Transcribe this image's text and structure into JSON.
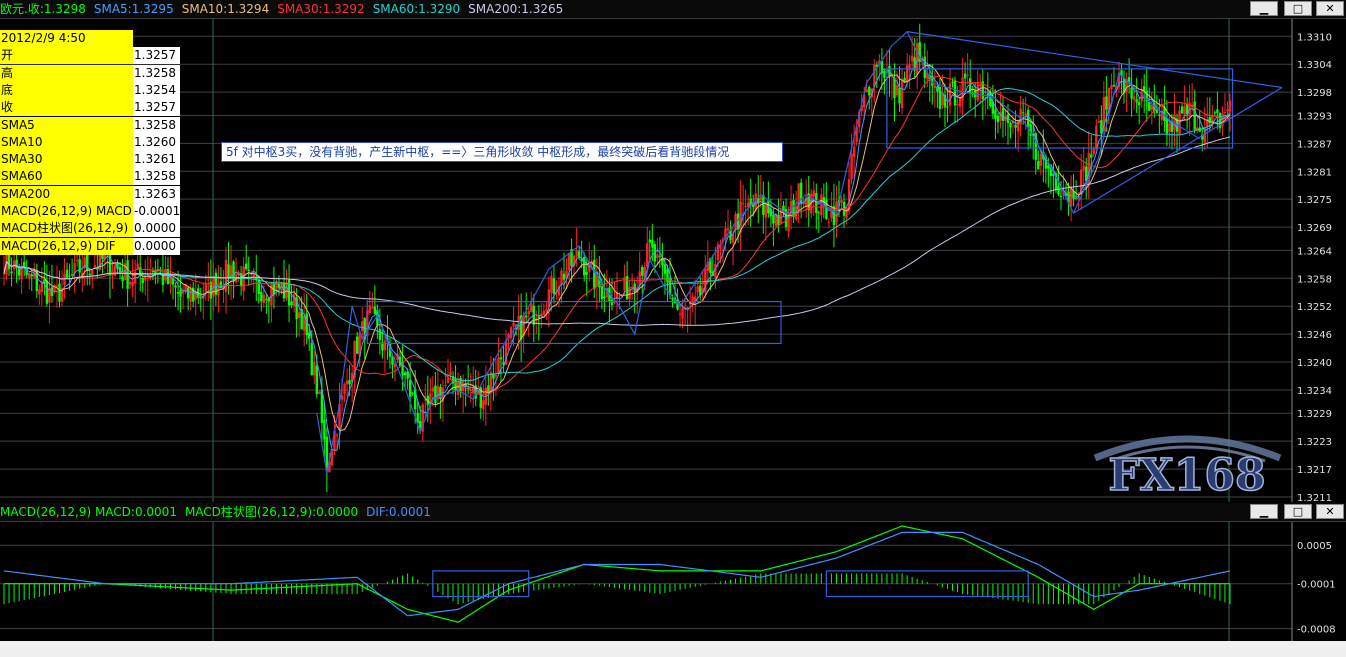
{
  "window": {
    "title_parts": [
      {
        "text": "欧元.收:1.3298",
        "color": "#00ff00"
      },
      {
        "text": "SMA5:1.3295",
        "color": "#40a0ff"
      },
      {
        "text": "SMA10:1.3294",
        "color": "#e8c070"
      },
      {
        "text": "SMA30:1.3292",
        "color": "#ff3030"
      },
      {
        "text": "SMA60:1.3290",
        "color": "#20d0d0"
      },
      {
        "text": "SMA200:1.3265",
        "color": "#c8c8e8"
      }
    ],
    "minimize": "▁",
    "maximize": "□",
    "close": "✕"
  },
  "info": {
    "rows": [
      {
        "k": "2012/2/9 4:50",
        "v": ""
      },
      {
        "k": "开",
        "v": "1.3257"
      },
      {
        "k": "高",
        "v": "1.3258"
      },
      {
        "k": "底",
        "v": "1.3254"
      },
      {
        "k": "收",
        "v": "1.3257"
      },
      {
        "k": "SMA5",
        "v": "1.3258"
      },
      {
        "k": "SMA10",
        "v": "1.3260"
      },
      {
        "k": "SMA30",
        "v": "1.3261"
      },
      {
        "k": "SMA60",
        "v": "1.3258"
      },
      {
        "k": "SMA200",
        "v": "1.3263"
      },
      {
        "k": "MACD(26,12,9) MACD",
        "v": "-0.0001"
      },
      {
        "k": "MACD柱状图(26,12,9)",
        "v": "0.0000"
      },
      {
        "k": "MACD(26,12,9) DIF",
        "v": "0.0000"
      }
    ]
  },
  "annotation": "5f 对中枢3买，没有背驰，产生新中枢，==〉三角形收敛 中枢形成，最终突破后看背驰段情况",
  "macd_title_parts": [
    {
      "text": "MACD(26,12,9) MACD:0.0001",
      "color": "#00ff00"
    },
    {
      "text": "MACD柱状图(26,12,9):0.0000",
      "color": "#00ff00"
    },
    {
      "text": "DIF:0.0001",
      "color": "#4090ff"
    }
  ],
  "watermark": "FX168",
  "colors": {
    "up": "#ff2020",
    "down": "#00ff00",
    "sma5": "#40a0ff",
    "sma10": "#e8c070",
    "sma30": "#ff3030",
    "sma60": "#20d0d0",
    "sma200": "#c8c8e8",
    "annot": "#3060e0",
    "grid": "#404040",
    "macd": "#00ff00",
    "dif": "#4090ff"
  },
  "chart_data": [
    {
      "type": "candlestick",
      "title": "欧元",
      "ylim": [
        1.3211,
        1.3312
      ],
      "y_ticks": [
        "1.3310",
        "1.3304",
        "1.3298",
        "1.3293",
        "1.3287",
        "1.3281",
        "1.3275",
        "1.3269",
        "1.3264",
        "1.3258",
        "1.3252",
        "1.3246",
        "1.3240",
        "1.3234",
        "1.3229",
        "1.3223",
        "1.3217",
        "1.3211"
      ],
      "n_bars": 200,
      "anchors": [
        [
          0,
          1.3262
        ],
        [
          10,
          1.3258
        ],
        [
          20,
          1.3254
        ],
        [
          30,
          1.326
        ],
        [
          40,
          1.3262
        ],
        [
          50,
          1.3258
        ],
        [
          60,
          1.326
        ],
        [
          70,
          1.3254
        ],
        [
          80,
          1.3255
        ],
        [
          90,
          1.326
        ],
        [
          100,
          1.3256
        ],
        [
          110,
          1.3256
        ],
        [
          118,
          1.325
        ],
        [
          124,
          1.3235
        ],
        [
          128,
          1.3218
        ],
        [
          135,
          1.3234
        ],
        [
          140,
          1.3244
        ],
        [
          145,
          1.325
        ],
        [
          150,
          1.3244
        ],
        [
          158,
          1.3238
        ],
        [
          162,
          1.3232
        ],
        [
          165,
          1.3227
        ],
        [
          172,
          1.3234
        ],
        [
          180,
          1.3236
        ],
        [
          186,
          1.3233
        ],
        [
          190,
          1.3233
        ],
        [
          196,
          1.324
        ],
        [
          202,
          1.3246
        ],
        [
          212,
          1.3252
        ],
        [
          220,
          1.3258
        ],
        [
          228,
          1.3263
        ],
        [
          236,
          1.3256
        ],
        [
          244,
          1.3254
        ],
        [
          250,
          1.3258
        ],
        [
          256,
          1.3264
        ],
        [
          262,
          1.3258
        ],
        [
          268,
          1.325
        ],
        [
          274,
          1.3252
        ],
        [
          280,
          1.326
        ],
        [
          286,
          1.3266
        ],
        [
          292,
          1.3272
        ],
        [
          298,
          1.3274
        ],
        [
          304,
          1.3272
        ],
        [
          310,
          1.327
        ],
        [
          316,
          1.3277
        ],
        [
          322,
          1.3274
        ],
        [
          328,
          1.3272
        ],
        [
          334,
          1.3274
        ],
        [
          338,
          1.329
        ],
        [
          342,
          1.3298
        ],
        [
          346,
          1.3305
        ],
        [
          350,
          1.3302
        ],
        [
          354,
          1.3297
        ],
        [
          358,
          1.3302
        ],
        [
          362,
          1.3306
        ],
        [
          366,
          1.33
        ],
        [
          370,
          1.3296
        ],
        [
          378,
          1.3298
        ],
        [
          386,
          1.33
        ],
        [
          392,
          1.3296
        ],
        [
          398,
          1.329
        ],
        [
          404,
          1.3292
        ],
        [
          410,
          1.3284
        ],
        [
          416,
          1.328
        ],
        [
          422,
          1.3276
        ],
        [
          428,
          1.328
        ],
        [
          434,
          1.329
        ],
        [
          440,
          1.3302
        ],
        [
          446,
          1.3298
        ],
        [
          452,
          1.3296
        ],
        [
          456,
          1.3292
        ],
        [
          462,
          1.329
        ],
        [
          470,
          1.3294
        ],
        [
          476,
          1.329
        ],
        [
          482,
          1.3292
        ],
        [
          486,
          1.3296
        ]
      ],
      "overlay": {
        "zigzag": [
          [
            124,
            1.3229
          ],
          [
            128,
            1.3216
          ],
          [
            133,
            1.3231
          ],
          [
            138,
            1.3252
          ],
          [
            142,
            1.3245
          ],
          [
            148,
            1.325
          ],
          [
            158,
            1.3236
          ],
          [
            165,
            1.3225
          ],
          [
            170,
            1.3232
          ],
          [
            180,
            1.3234
          ],
          [
            186,
            1.3232
          ],
          [
            196,
            1.3242
          ],
          [
            206,
            1.325
          ],
          [
            216,
            1.326
          ],
          [
            228,
            1.3265
          ],
          [
            238,
            1.3256
          ],
          [
            244,
            1.3252
          ],
          [
            250,
            1.3246
          ],
          [
            256,
            1.3262
          ],
          [
            262,
            1.3256
          ],
          [
            268,
            1.3252
          ],
          [
            280,
            1.3262
          ],
          [
            290,
            1.327
          ],
          [
            300,
            1.3276
          ],
          [
            310,
            1.3272
          ],
          [
            318,
            1.3276
          ],
          [
            330,
            1.3272
          ],
          [
            342,
            1.33
          ],
          [
            352,
            1.3308
          ],
          [
            358,
            1.3311
          ],
          [
            368,
            1.33
          ],
          [
            380,
            1.3298
          ],
          [
            392,
            1.3297
          ],
          [
            404,
            1.3292
          ],
          [
            414,
            1.3283
          ],
          [
            424,
            1.3272
          ],
          [
            434,
            1.3284
          ],
          [
            442,
            1.3302
          ],
          [
            450,
            1.3298
          ],
          [
            462,
            1.3292
          ],
          [
            474,
            1.3288
          ]
        ],
        "boxes": [
          {
            "x0": 144,
            "x1": 308,
            "y0": 1.3244,
            "y1": 1.3253
          },
          {
            "x0": 350,
            "x1": 487,
            "y0": 1.3286,
            "y1": 1.3303
          }
        ]
      }
    },
    {
      "type": "macd",
      "title": "MACD(26,12,9)",
      "ylim": [
        -0.0009,
        0.0008
      ],
      "y_ticks": [
        "0.0005",
        "-0.0001",
        "-0.0008"
      ],
      "macd_anchors": [
        [
          0,
          -0.0001
        ],
        [
          40,
          -0.0001
        ],
        [
          90,
          -0.0002
        ],
        [
          140,
          -0.0001
        ],
        [
          160,
          -0.0005
        ],
        [
          180,
          -0.0007
        ],
        [
          200,
          -0.0002
        ],
        [
          230,
          0.0002
        ],
        [
          260,
          0.0001
        ],
        [
          300,
          0.0001
        ],
        [
          330,
          0.0004
        ],
        [
          356,
          0.0008
        ],
        [
          380,
          0.0006
        ],
        [
          410,
          0.0
        ],
        [
          432,
          -0.0005
        ],
        [
          450,
          -0.0001
        ],
        [
          486,
          -0.0001
        ]
      ],
      "dif_anchors": [
        [
          0,
          0.0001
        ],
        [
          40,
          -0.0001
        ],
        [
          90,
          -0.0001
        ],
        [
          140,
          0.0
        ],
        [
          160,
          -0.0006
        ],
        [
          180,
          -0.0005
        ],
        [
          200,
          -0.0001
        ],
        [
          230,
          0.0002
        ],
        [
          260,
          0.0002
        ],
        [
          300,
          0.0
        ],
        [
          330,
          0.0003
        ],
        [
          356,
          0.0007
        ],
        [
          380,
          0.0007
        ],
        [
          410,
          0.0002
        ],
        [
          432,
          -0.0003
        ],
        [
          450,
          -0.0002
        ],
        [
          486,
          0.0001
        ]
      ],
      "boxes": [
        {
          "x0": 170,
          "x1": 208,
          "y0": -0.0003,
          "y1": 0.0001
        },
        {
          "x0": 326,
          "x1": 406,
          "y0": -0.0003,
          "y1": 0.0001
        }
      ]
    }
  ]
}
